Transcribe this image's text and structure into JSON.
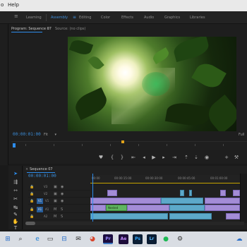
{
  "menu": {
    "help_label": "Help",
    "window_partial": "o"
  },
  "workspaces": {
    "items": [
      "Learning",
      "Assembly",
      "Editing",
      "Color",
      "Effects",
      "Audio",
      "Graphics",
      "Libraries"
    ],
    "active": "Assembly",
    "menu_icon": "hamburger-icon"
  },
  "program_monitor": {
    "tab_label": "Program: Sequence 07",
    "tab_menu_glyph": "≡",
    "source_tab_label": "Source: (no clips)",
    "timecode": "00:00:01:00",
    "fit_label": "Fit",
    "full_label": "Full",
    "transport_icons": [
      "marker-icon",
      "mark-in-icon",
      "mark-out-icon",
      "go-to-in-icon",
      "step-back-icon",
      "play-icon",
      "step-forward-icon",
      "go-to-out-icon",
      "lift-icon",
      "extract-icon",
      "export-frame-icon",
      "add-button-icon"
    ]
  },
  "timeline": {
    "sequence_label": "Sequence 07",
    "timecode": "00:00:01:00",
    "ruler_labels": [
      "00:00",
      "00:00:15:00",
      "00:00:30:00",
      "00:00:45:00",
      "00:01:00:00",
      "00:01:15:00"
    ],
    "tracks": [
      "V3",
      "V2",
      "V1",
      "A1",
      "A2"
    ],
    "source_patch": "V1",
    "clip_label": "Nested"
  },
  "tools": [
    "selection-tool-icon",
    "track-select-icon",
    "ripple-edit-icon",
    "razor-icon",
    "slip-icon",
    "pen-icon",
    "hand-icon",
    "type-icon"
  ],
  "taskbar": {
    "apps": [
      "windows-start-icon",
      "search-icon",
      "edge-icon",
      "file-explorer-icon",
      "store-icon",
      "mail-icon",
      "chrome-icon",
      "premiere-pro-icon",
      "after-effects-icon",
      "photoshop-icon",
      "lightroom-icon",
      "spotify-icon",
      "settings-icon",
      "onedrive-icon"
    ],
    "app_texts": {
      "premiere": "Pr",
      "after_effects": "Ae",
      "photoshop": "Ps",
      "lightroom": "Lr"
    }
  }
}
